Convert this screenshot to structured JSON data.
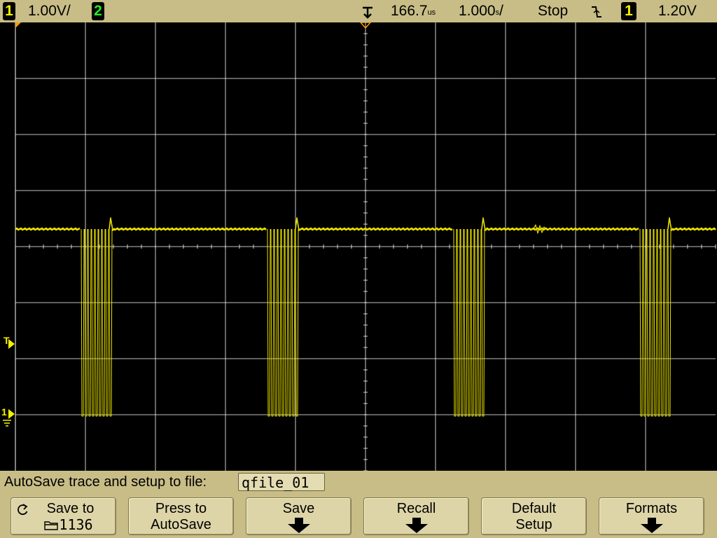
{
  "status_bar": {
    "channel1": {
      "number": "1",
      "scale": "1.00V/"
    },
    "channel2": {
      "number": "2"
    },
    "time_delay": "166.7",
    "time_delay_unit": "us",
    "time_scale": "1.000",
    "time_scale_unit": "s",
    "run_state": "Stop",
    "trigger_slope_icon": "falling-edge-icon",
    "trigger_source": "1",
    "trigger_level": "1.20V"
  },
  "markers": {
    "trigger_level_marker": "T",
    "channel1_ground_marker": "1"
  },
  "autosave": {
    "label": "AutoSave trace and setup to file:",
    "file_name": "qfile_01"
  },
  "softkeys": [
    {
      "line1": "Save to",
      "line2": "1136",
      "icon": "refresh-icon",
      "icon2": "folder-icon"
    },
    {
      "line1": "Press to",
      "line2": "AutoSave"
    },
    {
      "line1": "Save",
      "icon": "down-arrow-icon"
    },
    {
      "line1": "Recall",
      "icon": "down-arrow-icon"
    },
    {
      "line1": "Default",
      "line2": "Setup"
    },
    {
      "line1": "Formats",
      "icon": "down-arrow-icon"
    }
  ],
  "colors": {
    "trace": "#e8e000",
    "grid": "#ffffff",
    "panel": "#c8bd86",
    "background": "#000000",
    "channel2": "#22ee22",
    "marker_orange": "#ff9900"
  }
}
